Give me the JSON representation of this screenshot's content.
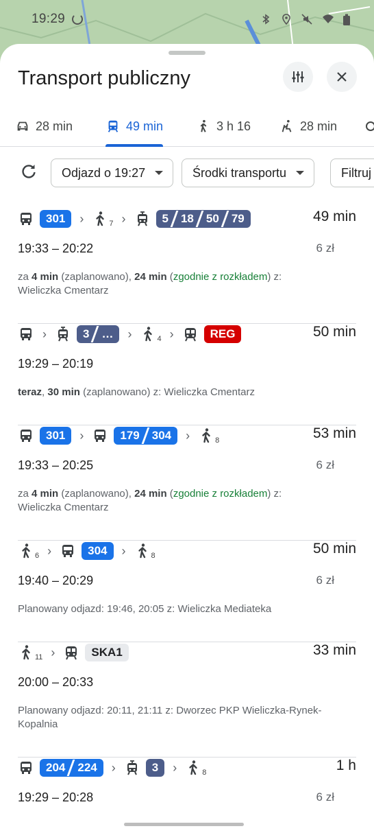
{
  "status_bar": {
    "time": "19:29"
  },
  "sheet": {
    "title": "Transport publiczny",
    "tune_icon": "tune-icon",
    "close_icon": "close-icon"
  },
  "tabs": [
    {
      "icon": "car-icon",
      "label": "28 min",
      "active": false
    },
    {
      "icon": "transit-icon",
      "label": "49 min",
      "active": true
    },
    {
      "icon": "walk-icon",
      "label": "3 h 16",
      "active": false
    },
    {
      "icon": "wheelchair-icon",
      "label": "28 min",
      "active": false
    }
  ],
  "filters": {
    "refresh_icon": "refresh-icon",
    "departure": "Odjazd o 19:27",
    "modes": "Środki transportu",
    "filter": "Filtruj"
  },
  "results": [
    {
      "legs": [
        {
          "type": "bus",
          "badges": [
            "301"
          ],
          "color": "blue"
        },
        {
          "type": "walk",
          "sub": "7"
        },
        {
          "type": "tram",
          "badges": [
            "5",
            "18",
            "50",
            "79"
          ],
          "color": "slate"
        }
      ],
      "duration": "49 min",
      "times": "19:33 – 20:22",
      "price": "6 zł",
      "info_parts": [
        {
          "t": "za "
        },
        {
          "t": "4 min",
          "s": "b"
        },
        {
          "t": " (zaplanowano), "
        },
        {
          "t": "24 min",
          "s": "b"
        },
        {
          "t": " ("
        },
        {
          "t": "zgodnie z rozkładem",
          "s": "g"
        },
        {
          "t": ") z: Wieliczka Cmentarz"
        }
      ]
    },
    {
      "legs": [
        {
          "type": "bus"
        },
        {
          "type": "tram",
          "badges": [
            "3",
            "…"
          ],
          "color": "slate"
        },
        {
          "type": "walk",
          "sub": "4"
        },
        {
          "type": "train",
          "badges": [
            "REG"
          ],
          "color": "red"
        }
      ],
      "duration": "50 min",
      "times": "19:29 – 20:19",
      "price": "",
      "info_parts": [
        {
          "t": "teraz",
          "s": "b"
        },
        {
          "t": ", "
        },
        {
          "t": "30 min",
          "s": "b"
        },
        {
          "t": " (zaplanowano) z: Wieliczka Cmentarz"
        }
      ]
    },
    {
      "legs": [
        {
          "type": "bus",
          "badges": [
            "301"
          ],
          "color": "blue"
        },
        {
          "type": "bus",
          "badges": [
            "179",
            "304"
          ],
          "color": "blue"
        },
        {
          "type": "walk",
          "sub": "8"
        }
      ],
      "duration": "53 min",
      "times": "19:33 – 20:25",
      "price": "6 zł",
      "info_parts": [
        {
          "t": "za "
        },
        {
          "t": "4 min",
          "s": "b"
        },
        {
          "t": " (zaplanowano), "
        },
        {
          "t": "24 min",
          "s": "b"
        },
        {
          "t": " ("
        },
        {
          "t": "zgodnie z rozkładem",
          "s": "g"
        },
        {
          "t": ") z: Wieliczka Cmentarz"
        }
      ]
    },
    {
      "legs": [
        {
          "type": "walk",
          "sub": "6"
        },
        {
          "type": "bus",
          "badges": [
            "304"
          ],
          "color": "blue"
        },
        {
          "type": "walk",
          "sub": "8"
        }
      ],
      "duration": "50 min",
      "times": "19:40 – 20:29",
      "price": "6 zł",
      "info_parts": [
        {
          "t": "Planowany odjazd: 19:46, 20:05 z: Wieliczka Mediateka"
        }
      ]
    },
    {
      "legs": [
        {
          "type": "walk",
          "sub": "11"
        },
        {
          "type": "train",
          "badges": [
            "SKA1"
          ],
          "color": "grey"
        }
      ],
      "duration": "33 min",
      "times": "20:00 – 20:33",
      "price": "",
      "info_parts": [
        {
          "t": "Planowany odjazd: 20:11, 21:11 z: Dworzec PKP Wieliczka-Rynek-Kopalnia"
        }
      ]
    },
    {
      "legs": [
        {
          "type": "bus",
          "badges": [
            "204",
            "224"
          ],
          "color": "blue"
        },
        {
          "type": "tram",
          "badges": [
            "3"
          ],
          "color": "slate"
        },
        {
          "type": "walk",
          "sub": "8"
        }
      ],
      "duration": "1 h",
      "times": "19:29 – 20:28",
      "price": "6 zł",
      "info_parts": []
    }
  ]
}
